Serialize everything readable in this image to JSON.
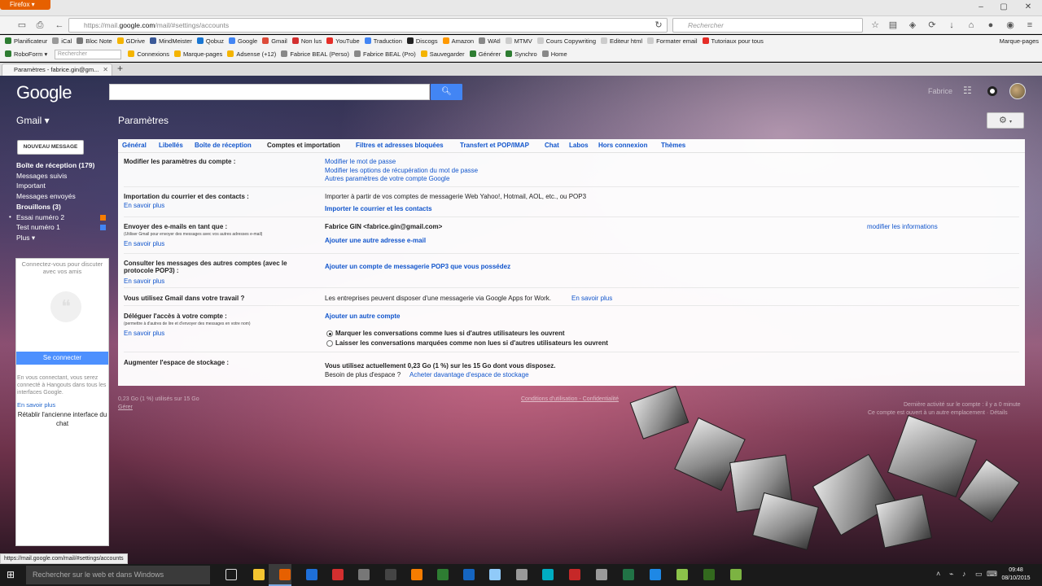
{
  "browser": {
    "firefox_label": "Firefox",
    "url_prefix": "https://mail.",
    "url_domain": "google.com",
    "url_rest": "/mail/#settings/accounts",
    "search_placeholder": "Rechercher",
    "bookmarks": [
      {
        "label": "Planificateur",
        "color": "#2e7d32"
      },
      {
        "label": "iCal",
        "color": "#999999"
      },
      {
        "label": "Bloc Note",
        "color": "#777777"
      },
      {
        "label": "GDrive",
        "color": "#f4b400"
      },
      {
        "label": "MindMeister",
        "color": "#3b5998"
      },
      {
        "label": "Qobuz",
        "color": "#1976d2"
      },
      {
        "label": "Google",
        "color": "#4285f4"
      },
      {
        "label": "Gmail",
        "color": "#dd4b39"
      },
      {
        "label": "Non lus",
        "color": "#d32f2f"
      },
      {
        "label": "YouTube",
        "color": "#e52d27"
      },
      {
        "label": "Traduction",
        "color": "#4285f4"
      },
      {
        "label": "Discogs",
        "color": "#222222"
      },
      {
        "label": "Amazon",
        "color": "#ff9900"
      },
      {
        "label": "WAtl",
        "color": "#888888"
      },
      {
        "label": "MTMV",
        "color": "#cccccc"
      },
      {
        "label": "Cours Copywriting",
        "color": "#cccccc"
      },
      {
        "label": "Editeur html",
        "color": "#cccccc"
      },
      {
        "label": "Formater email",
        "color": "#cccccc"
      },
      {
        "label": "Tutoriaux pour tous",
        "color": "#e52d27"
      }
    ],
    "bookmarks_other": "Marque-pages",
    "roboform_label": "RoboForm",
    "roboform_search": "Rechercher",
    "roboform_items": [
      "Connexions",
      "Marque-pages",
      "Adsense (+12)",
      "Fabrice BEAL (Perso)",
      "Fabrice BEAL (Pro)",
      "Sauvegarder",
      "Générer",
      "Synchro",
      "Home"
    ],
    "tab_title": "Paramètres - fabrice.gin@gm...",
    "status_url": "https://mail.google.com/mail/#settings/accounts"
  },
  "gmail": {
    "logo": "Google",
    "product": "Gmail ▾",
    "title": "Paramètres",
    "compose": "NOUVEAU MESSAGE",
    "user_name": "Fabrice",
    "nav": [
      {
        "label": "Boîte de réception (179)",
        "bold": true
      },
      {
        "label": "Messages suivis",
        "bold": false
      },
      {
        "label": "Important",
        "bold": false
      },
      {
        "label": "Messages envoyés",
        "bold": false
      },
      {
        "label": "Brouillons (3)",
        "bold": true
      },
      {
        "label": "Essai numéro 2",
        "bold": false,
        "color": "#f57c00",
        "dot": true
      },
      {
        "label": "Test numéro 1",
        "bold": false,
        "color": "#4285f4"
      },
      {
        "label": "Plus ▾",
        "bold": false
      }
    ],
    "chat": {
      "top_text": "Connectez-vous pour discuter avec vos amis",
      "signin": "Se connecter",
      "info": "En vous connectant, vous serez connecté à Hangouts dans tous les interfaces Google.",
      "learn_more": "En savoir plus",
      "restore": "Rétablir l'ancienne interface du chat"
    },
    "tabs": [
      "Général",
      "Libellés",
      "Boîte de réception",
      "Comptes et importation",
      "Filtres et adresses bloquées",
      "Transfert et POP/IMAP",
      "Chat",
      "Labos",
      "Hors connexion",
      "Thèmes"
    ],
    "active_tab": "Comptes et importation",
    "sections": {
      "modify": {
        "label": "Modifier les paramètres du compte :",
        "links": [
          "Modifier le mot de passe",
          "Modifier les options de récupération du mot de passe",
          "Autres paramètres de votre compte Google"
        ]
      },
      "import": {
        "label": "Importation du courrier et des contacts :",
        "learn": "En savoir plus",
        "text": "Importer à partir de vos comptes de messagerie Web Yahoo!, Hotmail, AOL, etc., ou POP3",
        "link": "Importer le courrier et les contacts"
      },
      "send_as": {
        "label": "Envoyer des e-mails en tant que :",
        "sub": "(Utiliser Gmail pour envoyer des messages avec vos autres adresses e-mail)",
        "learn": "En savoir plus",
        "address": "Fabrice GIN <fabrice.gin@gmail.com>",
        "edit": "modifier les informations",
        "add": "Ajouter une autre adresse e-mail"
      },
      "pop3": {
        "label": "Consulter les messages des autres comptes (avec le protocole POP3) :",
        "learn": "En savoir plus",
        "link": "Ajouter un compte de messagerie POP3 que vous possédez"
      },
      "work": {
        "label": "Vous utilisez Gmail dans votre travail ?",
        "text": "Les entreprises peuvent disposer d'une messagerie via Google Apps for Work.",
        "link": "En savoir plus"
      },
      "delegate": {
        "label": "Déléguer l'accès à votre compte :",
        "sub": "(permettre à d'autres de lire et d'envoyer des messages en votre nom)",
        "learn": "En savoir plus",
        "link": "Ajouter un autre compte",
        "option1": "Marquer les conversations comme lues si d'autres utilisateurs les ouvrent",
        "option2": "Laisser les conversations marquées comme non lues si d'autres utilisateurs les ouvrent",
        "selected": 1
      },
      "storage": {
        "label": "Augmenter l'espace de stockage :",
        "text": "Vous utilisez actuellement 0,23 Go (1 %) sur les 15 Go dont vous disposez.",
        "text2": "Besoin de plus d'espace ?",
        "link": "Acheter davantage d'espace de stockage"
      }
    },
    "footer": {
      "usage": "0,23 Go (1 %) utilisés sur 15 Go",
      "manage": "Gérer",
      "terms": "Conditions d'utilisation - Confidentialité",
      "activity": "Dernière activité sur le compte : il y a 0 minute",
      "details": "Ce compte est ouvert à un autre emplacement · Détails"
    }
  },
  "taskbar": {
    "search": "Rechercher sur le web et dans Windows",
    "time": "09:48",
    "date": "08/10/2015"
  }
}
